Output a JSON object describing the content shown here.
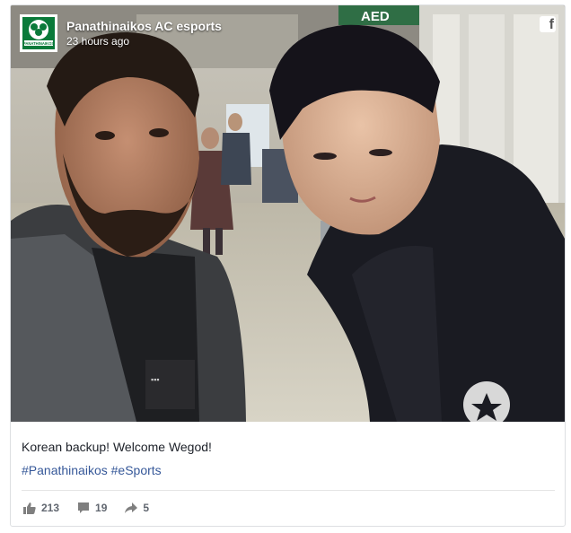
{
  "post": {
    "page_name": "Panathinaikos AC esports",
    "time": "23 hours ago",
    "text": "Korean backup! Welcome Wegod!",
    "hashtags": [
      "#Panathinaikos",
      "#eSports"
    ],
    "photo_signage": "AED",
    "logo_text": "PANATHINAIKOS"
  },
  "stats": {
    "likes": "213",
    "comments": "19",
    "shares": "5"
  },
  "icons": {
    "platform": "facebook-icon",
    "like": "thumbs-up-icon",
    "comment": "comment-icon",
    "share": "share-arrow-icon"
  },
  "colors": {
    "link": "#365899",
    "text": "#1d2129",
    "muted": "#616770",
    "logo_green": "#0a7a3a"
  }
}
